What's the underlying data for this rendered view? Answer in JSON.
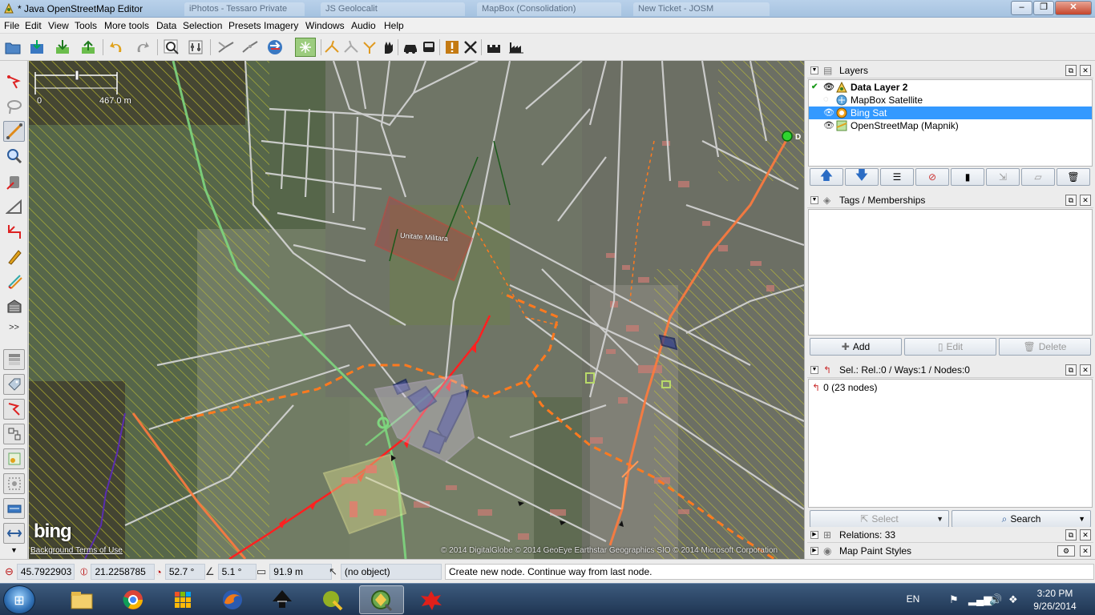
{
  "window": {
    "title": "* Java OpenStreetMap Editor",
    "ghost_tabs": [
      "iPhotos - Tessaro Private",
      "JS Geolocalit",
      "MapBox (Consolidation)",
      "New Ticket - JOSM"
    ],
    "buttons": {
      "minimize": "–",
      "maximize": "❐",
      "close": "✕"
    }
  },
  "menu": [
    "File",
    "Edit",
    "View",
    "Tools",
    "More tools",
    "Data",
    "Selection",
    "Presets",
    "Imagery",
    "Windows",
    "Audio",
    "Help"
  ],
  "toolbar_icons": [
    "open-file-icon",
    "save-icon",
    "download-icon",
    "upload-icon",
    "undo-icon",
    "redo-icon",
    "zoom-data-icon",
    "preferences-icon",
    "combine-way-icon",
    "split-way-icon",
    "reverse-way-icon",
    "align-circle-icon",
    "simplify-icon",
    "unglue-icon",
    "orthogonalize-icon",
    "move-icon",
    "car-icon",
    "bus-icon",
    "validator-icon",
    "delete-icon",
    "castle-icon",
    "factory-icon"
  ],
  "left_tools": [
    "select-tool-icon",
    "lasso-tool-icon",
    "draw-tool-icon",
    "zoom-tool-icon",
    "delete-tool-icon",
    "parallel-tool-icon",
    "improve-way-tool-icon",
    "pencil-tool-icon",
    "extrude-tool-icon",
    "building-tool-icon",
    "more-tools-icon",
    "layers-toggle-icon",
    "tags-toggle-icon",
    "selection-toggle-icon",
    "relations-toggle-icon",
    "history-toggle-icon",
    "conflicts-toggle-icon",
    "filter-toggle-icon",
    "measurement-toggle-icon",
    "minimap-toggle-icon"
  ],
  "left_more_label": ">>",
  "map": {
    "scale": {
      "start": "0",
      "end": "467.0 m"
    },
    "feature_label": "Unitate Militara",
    "node_label": "D",
    "bing_logo": "bing",
    "background_terms": "Background Terms of Use",
    "attribution": "© 2014 DigitalGlobe © 2014 GeoEye Earthstar Geographics SIO © 2014 Microsoft Corporation"
  },
  "layers_panel": {
    "title": "Layers",
    "layers": [
      {
        "name": "Data Layer 2",
        "active": true,
        "visible": true,
        "selected": false,
        "icon": "data-layer-icon"
      },
      {
        "name": "MapBox Satellite",
        "active": false,
        "visible": false,
        "selected": false,
        "icon": "imagery-layer-icon"
      },
      {
        "name": "Bing Sat",
        "active": false,
        "visible": true,
        "selected": true,
        "icon": "imagery-layer-icon"
      },
      {
        "name": "OpenStreetMap (Mapnik)",
        "active": false,
        "visible": true,
        "selected": false,
        "icon": "imagery-layer-icon"
      }
    ],
    "button_icons": [
      "move-up-icon",
      "move-down-icon",
      "activate-layer-icon",
      "show-hide-icon",
      "opacity-icon",
      "merge-icon",
      "duplicate-icon",
      "delete-layer-icon"
    ]
  },
  "tags_panel": {
    "title": "Tags / Memberships",
    "buttons": {
      "add": "Add",
      "edit": "Edit",
      "delete": "Delete"
    }
  },
  "selection_panel": {
    "title": "Sel.: Rel.:0 / Ways:1 / Nodes:0",
    "items": [
      "0 (23 nodes)"
    ],
    "buttons": {
      "select": "Select",
      "search": "Search"
    }
  },
  "relations_panel": {
    "title": "Relations: 33"
  },
  "mappaint_panel": {
    "title": "Map Paint Styles"
  },
  "status": {
    "lat": "45.7922903",
    "lon": "21.2258785",
    "heading": "52.7 °",
    "angle": "5.1 °",
    "length": "91.9 m",
    "object": "(no object)",
    "message": "Create new node. Continue way from last node."
  },
  "taskbar": {
    "apps": [
      "file-explorer-icon",
      "chrome-icon",
      "app-grid-icon",
      "firefox-icon",
      "inkscape-icon",
      "qgis-icon",
      "josm-icon",
      "paint-splash-icon"
    ],
    "active_app": "josm-icon",
    "lang": "EN",
    "time": "3:20 PM",
    "date": "9/26/2014"
  },
  "colors": {
    "selection_blue": "#3399ff",
    "selected_way": "#ff2a2a",
    "boundary_orange": "#ff7a1f",
    "highway_green": "#6fd36f"
  }
}
